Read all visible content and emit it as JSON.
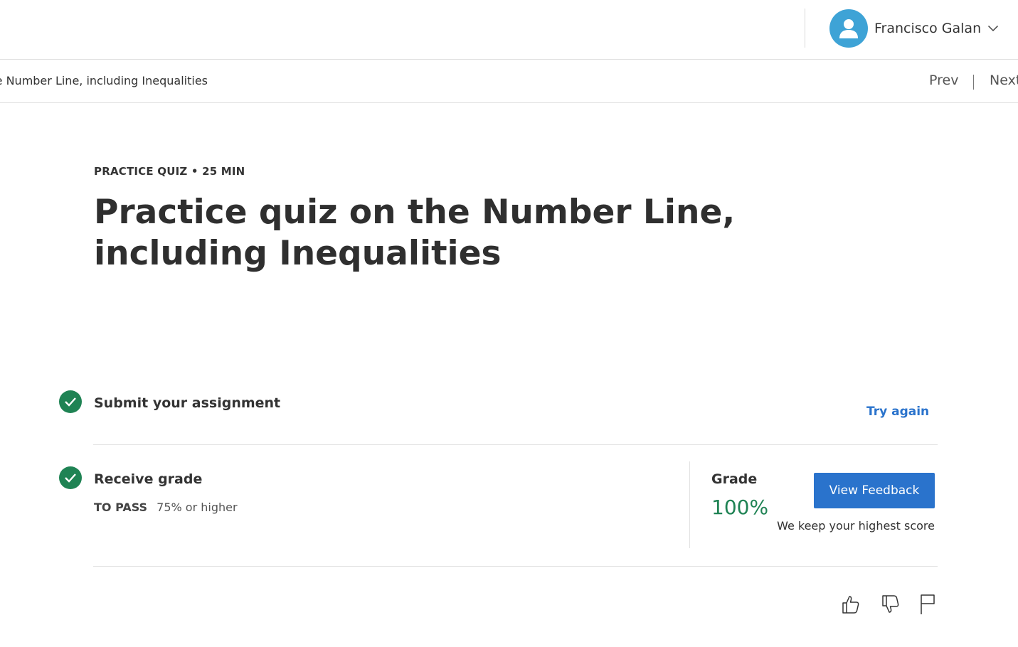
{
  "header": {
    "user_name": "Francisco Galan"
  },
  "breadcrumb": {
    "item_title": "Practice quiz on the Number Line, including Inequalities",
    "prev_label": "Prev",
    "next_label": "Next"
  },
  "quiz": {
    "meta": "PRACTICE QUIZ • 25 MIN",
    "title": "Practice quiz on the Number Line, including Inequalities"
  },
  "steps": {
    "submit": {
      "title": "Submit your assignment",
      "action_label": "Try again"
    },
    "grade": {
      "title": "Receive grade",
      "to_pass_label": "TO PASS",
      "to_pass_value": "75% or higher",
      "grade_label": "Grade",
      "grade_value": "100%",
      "feedback_button": "View Feedback",
      "keep_note": "We keep your highest score"
    }
  },
  "colors": {
    "accent_blue": "#2a73cc",
    "success_green": "#1f8354",
    "avatar_blue": "#3ea3d6"
  },
  "icons": [
    "user-avatar-icon",
    "chevron-down-icon",
    "check-icon",
    "thumbs-up-icon",
    "thumbs-down-icon",
    "flag-icon"
  ]
}
